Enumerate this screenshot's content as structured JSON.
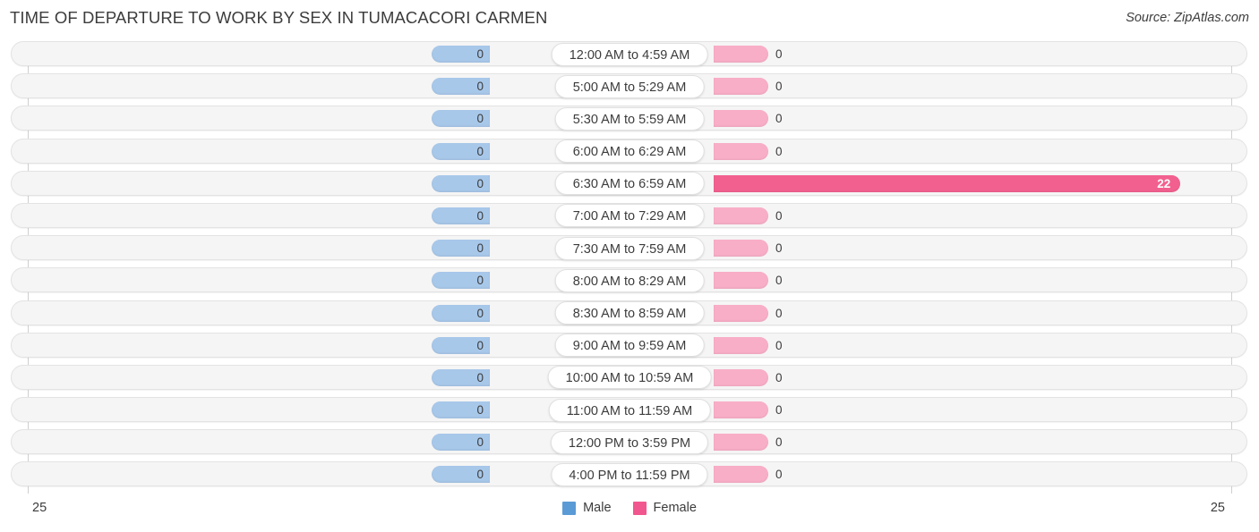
{
  "header": {
    "title": "TIME OF DEPARTURE TO WORK BY SEX IN TUMACACORI CARMEN",
    "source": "Source: ZipAtlas.com"
  },
  "axis": {
    "left_end": "25",
    "right_end": "25",
    "max": 25
  },
  "legend": {
    "male_label": "Male",
    "female_label": "Female",
    "male_color": "#5b9bd5",
    "female_color": "#f2568f"
  },
  "colors": {
    "male_bar": "#a8c8ea",
    "female_bar": "#f9aec8",
    "female_bar_highlight": "#f2608f",
    "track": "#f5f5f5",
    "text": "#3c3c3c"
  },
  "chart_data": {
    "type": "bar",
    "subtype": "diverging-bidirectional",
    "title": "TIME OF DEPARTURE TO WORK BY SEX IN TUMACACORI CARMEN",
    "xlabel": "",
    "ylabel": "",
    "xlim": [
      25,
      25
    ],
    "grid": false,
    "legend_position": "bottom-center",
    "categories": [
      "12:00 AM to 4:59 AM",
      "5:00 AM to 5:29 AM",
      "5:30 AM to 5:59 AM",
      "6:00 AM to 6:29 AM",
      "6:30 AM to 6:59 AM",
      "7:00 AM to 7:29 AM",
      "7:30 AM to 7:59 AM",
      "8:00 AM to 8:29 AM",
      "8:30 AM to 8:59 AM",
      "9:00 AM to 9:59 AM",
      "10:00 AM to 10:59 AM",
      "11:00 AM to 11:59 AM",
      "12:00 PM to 3:59 PM",
      "4:00 PM to 11:59 PM"
    ],
    "series": [
      {
        "name": "Male",
        "values": [
          0,
          0,
          0,
          0,
          0,
          0,
          0,
          0,
          0,
          0,
          0,
          0,
          0,
          0
        ]
      },
      {
        "name": "Female",
        "values": [
          0,
          0,
          0,
          0,
          22,
          0,
          0,
          0,
          0,
          0,
          0,
          0,
          0,
          0
        ]
      }
    ]
  },
  "rows": [
    {
      "label": "12:00 AM to 4:59 AM",
      "male": "0",
      "female": "0",
      "male_val": 0,
      "female_val": 0
    },
    {
      "label": "5:00 AM to 5:29 AM",
      "male": "0",
      "female": "0",
      "male_val": 0,
      "female_val": 0
    },
    {
      "label": "5:30 AM to 5:59 AM",
      "male": "0",
      "female": "0",
      "male_val": 0,
      "female_val": 0
    },
    {
      "label": "6:00 AM to 6:29 AM",
      "male": "0",
      "female": "0",
      "male_val": 0,
      "female_val": 0
    },
    {
      "label": "6:30 AM to 6:59 AM",
      "male": "0",
      "female": "22",
      "male_val": 0,
      "female_val": 22
    },
    {
      "label": "7:00 AM to 7:29 AM",
      "male": "0",
      "female": "0",
      "male_val": 0,
      "female_val": 0
    },
    {
      "label": "7:30 AM to 7:59 AM",
      "male": "0",
      "female": "0",
      "male_val": 0,
      "female_val": 0
    },
    {
      "label": "8:00 AM to 8:29 AM",
      "male": "0",
      "female": "0",
      "male_val": 0,
      "female_val": 0
    },
    {
      "label": "8:30 AM to 8:59 AM",
      "male": "0",
      "female": "0",
      "male_val": 0,
      "female_val": 0
    },
    {
      "label": "9:00 AM to 9:59 AM",
      "male": "0",
      "female": "0",
      "male_val": 0,
      "female_val": 0
    },
    {
      "label": "10:00 AM to 10:59 AM",
      "male": "0",
      "female": "0",
      "male_val": 0,
      "female_val": 0
    },
    {
      "label": "11:00 AM to 11:59 AM",
      "male": "0",
      "female": "0",
      "male_val": 0,
      "female_val": 0
    },
    {
      "label": "12:00 PM to 3:59 PM",
      "male": "0",
      "female": "0",
      "male_val": 0,
      "female_val": 0
    },
    {
      "label": "4:00 PM to 11:59 PM",
      "male": "0",
      "female": "0",
      "male_val": 0,
      "female_val": 0
    }
  ]
}
